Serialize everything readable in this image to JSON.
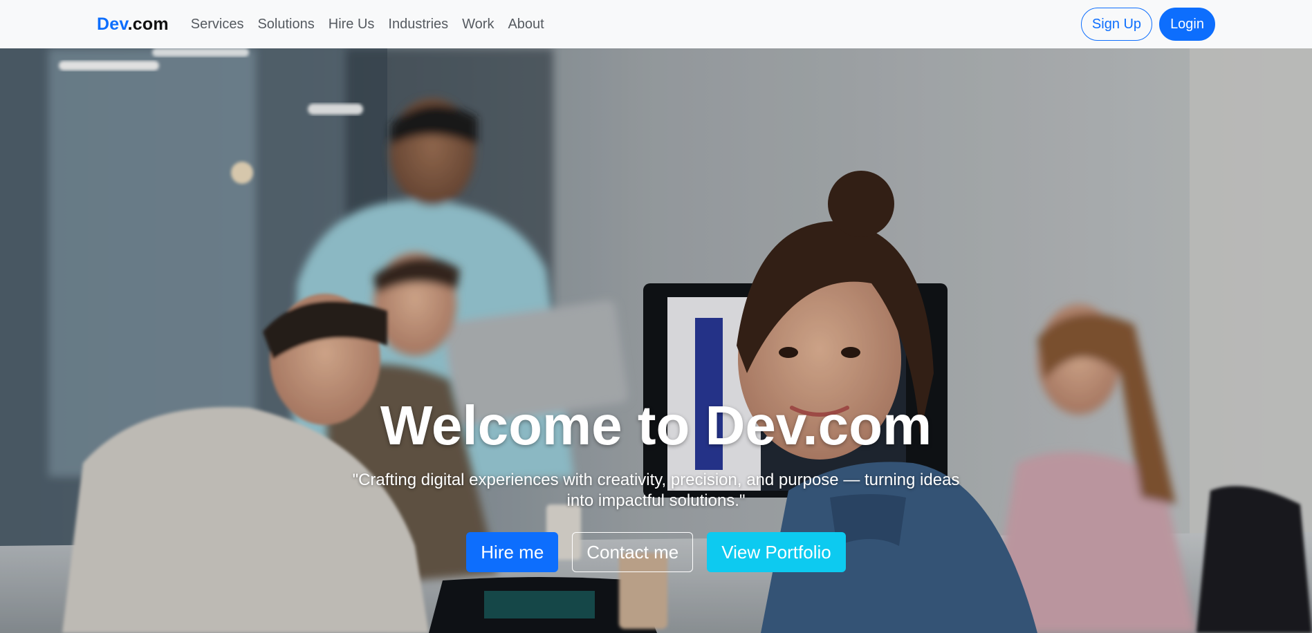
{
  "navbar": {
    "brand_primary": "Dev",
    "brand_secondary": ".com",
    "links": [
      "Services",
      "Solutions",
      "Hire Us",
      "Industries",
      "Work",
      "About"
    ],
    "signup_label": "Sign Up",
    "login_label": "Login"
  },
  "hero": {
    "title": "Welcome to Dev.com",
    "tagline": "\"Crafting digital experiences with creativity, precision, and purpose — turning ideas into impactful solutions.\"",
    "hire_label": "Hire me",
    "contact_label": "Contact me",
    "portfolio_label": "View Portfolio",
    "background_icon": "team-meeting-photo"
  },
  "colors": {
    "primary": "#0d6efd",
    "info": "#0dcaf0",
    "navbar_bg": "#f8f9fa",
    "nav_text": "#555a60"
  }
}
